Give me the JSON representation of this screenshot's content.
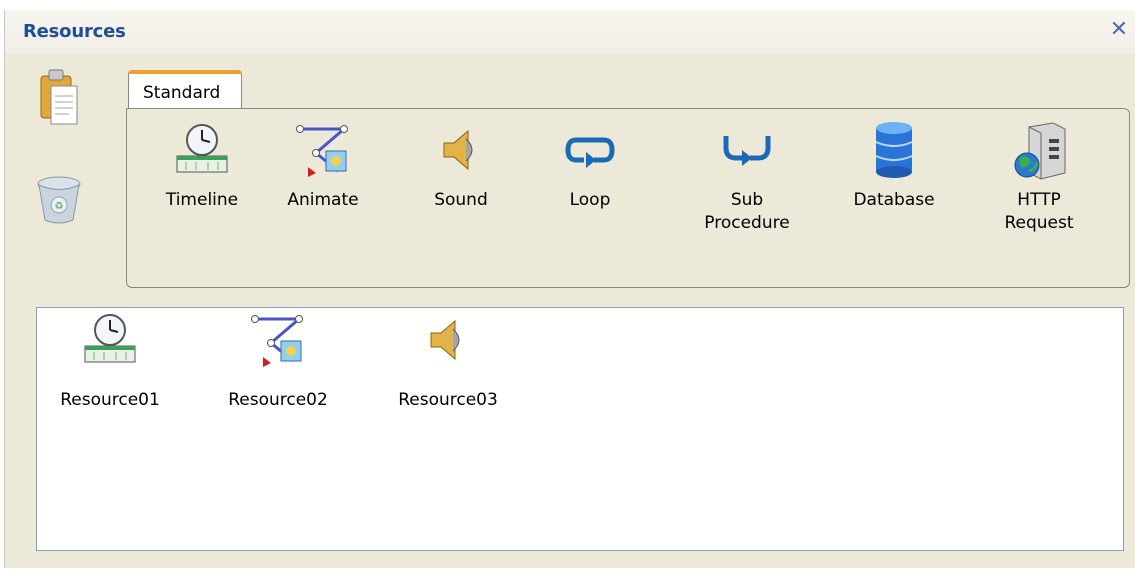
{
  "panel": {
    "title": "Resources",
    "close_icon": "close-icon",
    "side_icons": [
      "clipboard-icon",
      "recycle-bin-icon"
    ]
  },
  "tabs": [
    {
      "label": "Standard",
      "active": true
    }
  ],
  "toolbox": {
    "items": [
      {
        "label": "Timeline",
        "icon": "timeline-icon"
      },
      {
        "label": "Animate",
        "icon": "animate-icon"
      },
      {
        "label": "Sound",
        "icon": "sound-icon"
      },
      {
        "label": "Loop",
        "icon": "loop-icon"
      },
      {
        "label": "Sub\nProcedure",
        "icon": "sub-procedure-icon"
      },
      {
        "label": "Database",
        "icon": "database-icon"
      },
      {
        "label": "HTTP\nRequest",
        "icon": "http-request-icon"
      }
    ]
  },
  "resources": {
    "items": [
      {
        "label": "Resource01",
        "icon": "timeline-icon"
      },
      {
        "label": "Resource02",
        "icon": "animate-icon"
      },
      {
        "label": "Resource03",
        "icon": "sound-icon"
      }
    ]
  },
  "colors": {
    "title": "#1f4e99",
    "tab_accent": "#f0a030",
    "panel_bg": "#ece9d8"
  }
}
